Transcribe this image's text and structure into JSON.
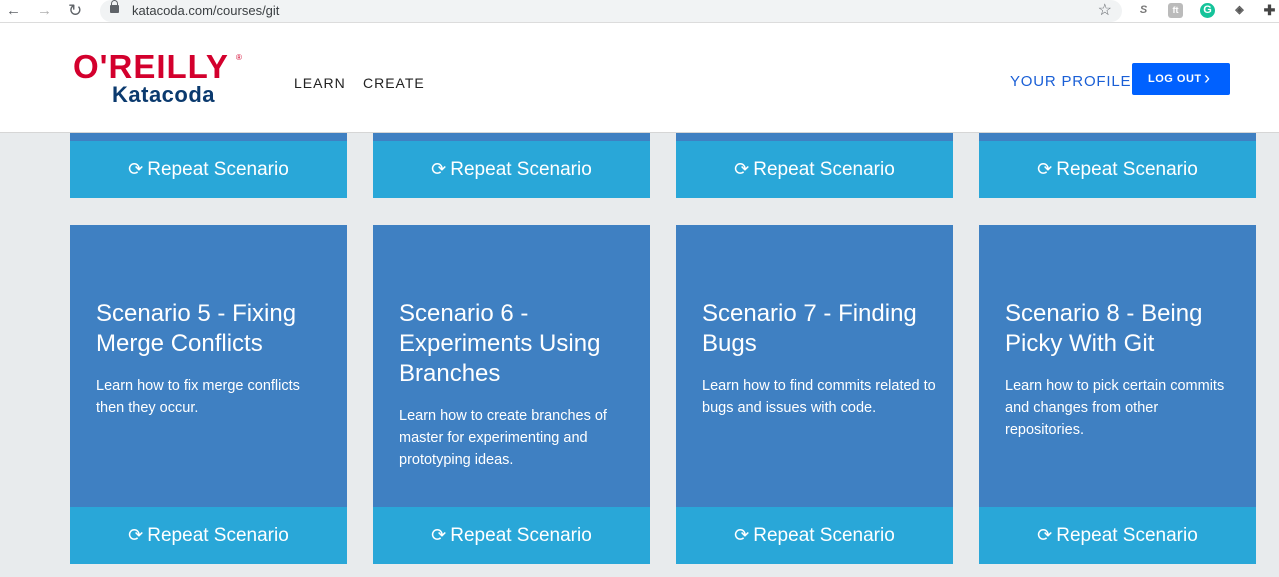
{
  "browser": {
    "url": "katacoda.com/courses/git",
    "back_icon": "←",
    "forward_icon": "→",
    "reload_icon": "↻",
    "star_icon": "☆",
    "extensions": [
      "S",
      "ft",
      "G",
      "◈",
      "✚"
    ]
  },
  "header": {
    "logo_top": "O'REILLY",
    "logo_reg": "®",
    "logo_bottom": "Katacoda",
    "nav": [
      "LEARN",
      "CREATE"
    ],
    "profile": "YOUR PROFILE",
    "logout": "LOG OUT",
    "logout_icon": "›"
  },
  "repeat_label": "Repeat Scenario",
  "repeat_icon": "⟳",
  "scenarios": [
    {
      "title": "Scenario 5 - Fixing Merge Conflicts",
      "desc": "Learn how to fix merge conflicts then they occur."
    },
    {
      "title": "Scenario 6 - Experiments Using Branches",
      "desc": "Learn how to create branches of master for experimenting and prototyping ideas."
    },
    {
      "title": "Scenario 7 - Finding Bugs",
      "desc": "Learn how to find commits related to bugs and issues with code."
    },
    {
      "title": "Scenario 8 - Being Picky With Git",
      "desc": "Learn how to pick certain commits and changes from other repositories."
    }
  ],
  "colors": {
    "card": "#3f80c2",
    "button": "#29a7d8",
    "brand_red": "#d3002d",
    "brand_navy": "#0b3a6e",
    "logout": "#0061ff"
  }
}
